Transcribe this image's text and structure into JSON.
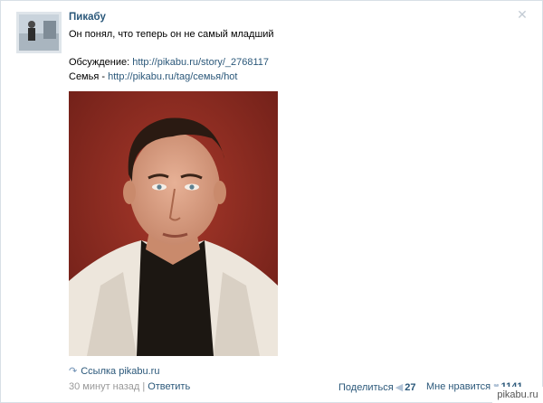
{
  "post": {
    "author": "Пикабу",
    "text": "Он понял, что теперь он не самый младший",
    "discussion_label": "Обсуждение: ",
    "discussion_link": "http://pikabu.ru/story/_2768117",
    "family_label": "Семья - ",
    "family_link": "http://pikabu.ru/tag/семья/hot",
    "close_glyph": "✕"
  },
  "attachment": {
    "label": "Ссылка pikabu.ru",
    "icon": "link-arrow-icon"
  },
  "meta": {
    "time": "30 минут назад",
    "separator": "|",
    "reply": "Ответить"
  },
  "actions": {
    "share_label": "Поделиться",
    "share_count": "27",
    "like_label": "Мне нравится",
    "like_count": "1141"
  },
  "watermark": "pikabu.ru",
  "colors": {
    "link": "#2b587a",
    "muted": "#999999",
    "icon": "#b0c2d6",
    "photo_bg": "#8e2a20"
  }
}
